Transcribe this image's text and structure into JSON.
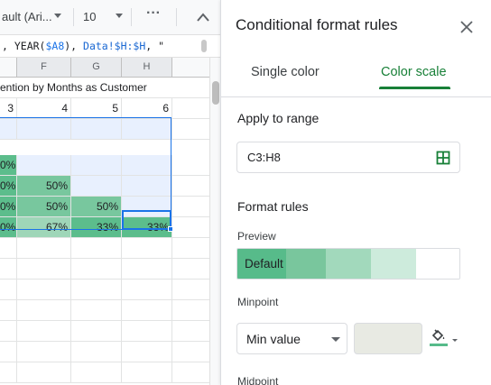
{
  "toolbar": {
    "font_name": "ault (Ari...",
    "font_size": "10",
    "more_label": "···"
  },
  "formula_bar": {
    "part1": ", YEAR(",
    "ref1": "$A8",
    "part2": "), ",
    "ref2": "Data!$H:$H",
    "part3": ", \""
  },
  "columns": [
    "F",
    "G",
    "H"
  ],
  "sheet": {
    "title": "ention by Months as Customer",
    "header_row": [
      "3",
      "4",
      "5",
      "6"
    ],
    "rows": [
      [
        "0%",
        "",
        "",
        ""
      ],
      [
        "0%",
        "50%",
        "",
        ""
      ],
      [
        "0%",
        "50%",
        "50%",
        ""
      ],
      [
        "0%",
        "67%",
        "33%",
        "33%"
      ]
    ]
  },
  "colors": {
    "cell_empty_fill": "#e8f0fe",
    "cell_high": "#57bb8a",
    "cell_mid": "#7ccaa0",
    "cell_low": "#a3d9bb",
    "accent": "#188038",
    "selection": "#1a73e8"
  },
  "panel": {
    "title": "Conditional format rules",
    "close_icon": "close-icon",
    "tabs": [
      {
        "label": "Single color",
        "selected": false
      },
      {
        "label": "Color scale",
        "selected": true
      }
    ],
    "apply_to_range_label": "Apply to range",
    "range_value": "C3:H8",
    "format_rules_label": "Format rules",
    "preview_label": "Preview",
    "preview_text": "Default",
    "preview_colors": [
      "#57bb8a",
      "#79c69d",
      "#a2d9bc",
      "#cdebdc",
      "#ffffff"
    ],
    "minpoint_label": "Minpoint",
    "minpoint_value": "Min value",
    "minpoint_color": "#e8eae3",
    "midpoint_label": "Midpoint"
  }
}
